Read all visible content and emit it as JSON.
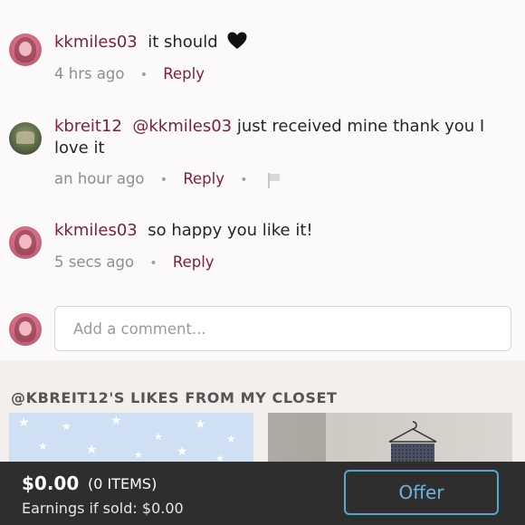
{
  "comments": [
    {
      "username": "kkmiles03",
      "mention": "",
      "text": "it should",
      "time": "4 hrs ago",
      "separator": "•",
      "reply_label": "Reply"
    },
    {
      "username": "kbreit12",
      "mention": "@kkmiles03",
      "text": "just received mine thank you I love it",
      "time": "an hour ago",
      "separator": "•",
      "reply_label": "Reply",
      "separator2": "•"
    },
    {
      "username": "kkmiles03",
      "mention": "",
      "text": "so happy you like it!",
      "time": "5 secs ago",
      "separator": "•",
      "reply_label": "Reply"
    }
  ],
  "add_comment": {
    "placeholder": "Add a comment..."
  },
  "likes_section": {
    "title": "@KBREIT12'S LIKES FROM MY CLOSET"
  },
  "bottom_bar": {
    "price": "$0.00",
    "items": "(0 ITEMS)",
    "earnings": "Earnings if sold: $0.00",
    "offer_label": "Offer"
  },
  "colors": {
    "username": "#7a2337",
    "offer": "#57a6cf",
    "bottom_bar": "#2e2e2e"
  },
  "icons": [
    "black-heart-icon",
    "flag-icon",
    "avatar-image"
  ]
}
